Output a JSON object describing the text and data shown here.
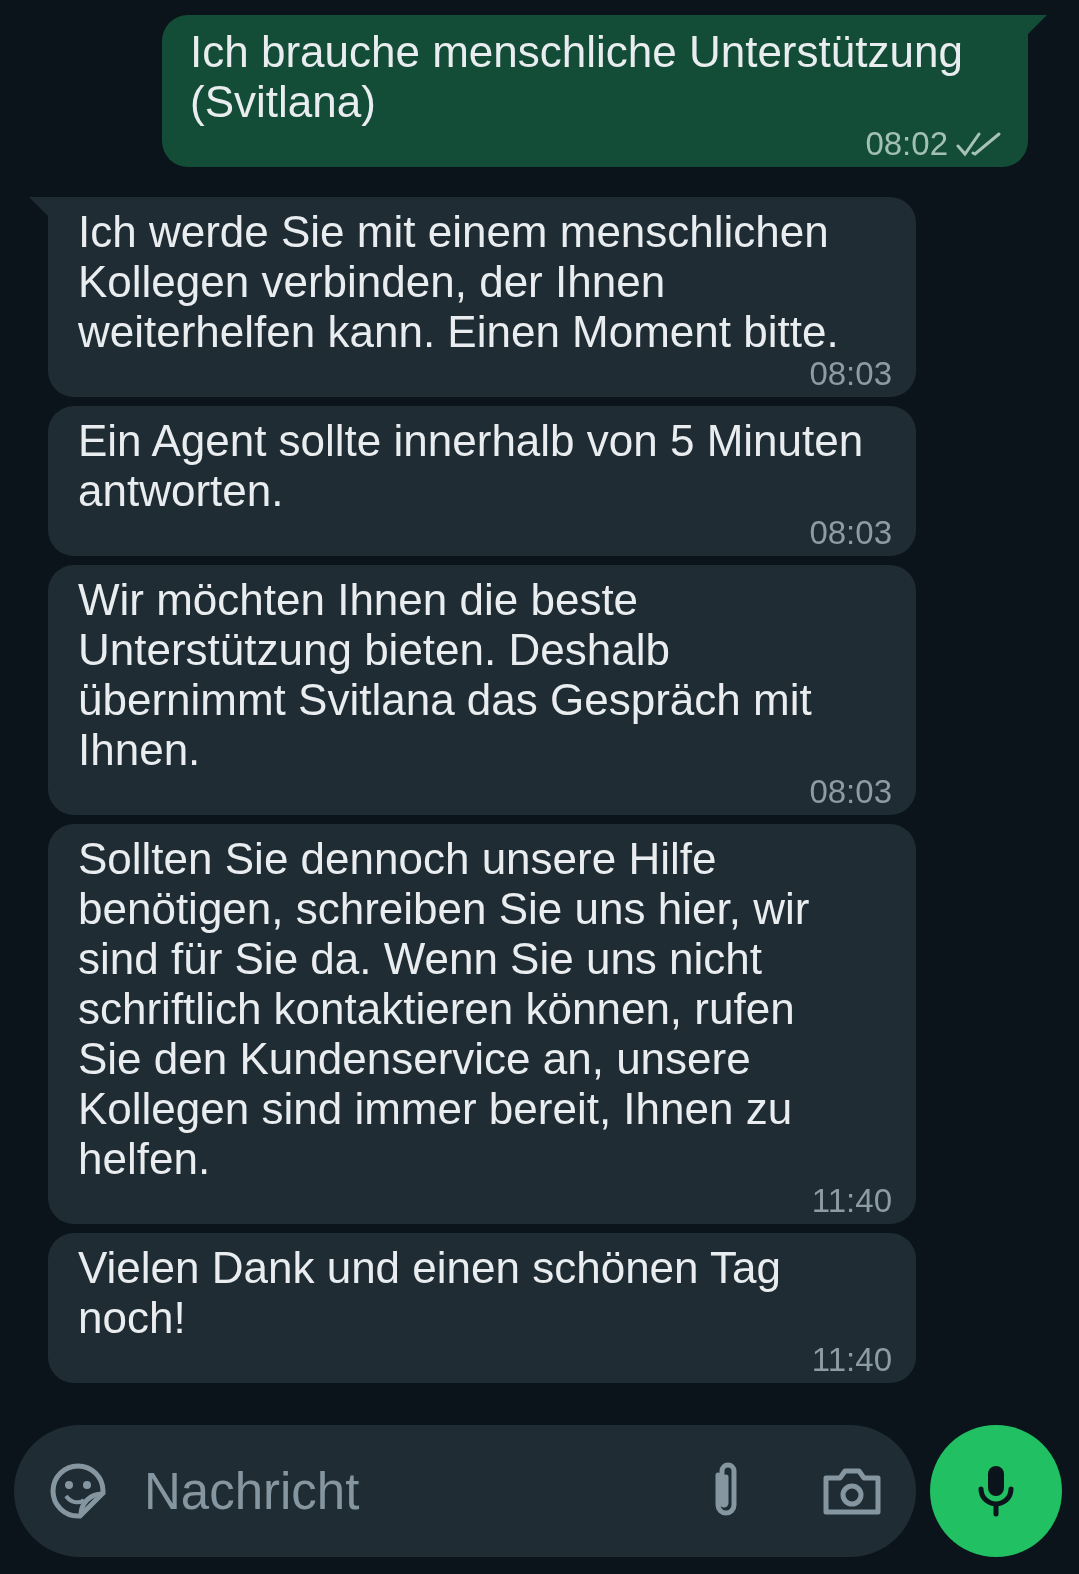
{
  "messages": [
    {
      "outgoing": true,
      "text": "Ich brauche menschliche Unterstützung\n(Svitlana)",
      "time": "08:02",
      "delivered": true,
      "tail": true
    },
    {
      "outgoing": false,
      "text": "Ich werde Sie mit einem menschlichen\nKollegen verbinden, der Ihnen\nweiterhelfen kann. Einen Moment bitte.",
      "time": "08:03",
      "tail": true
    },
    {
      "outgoing": false,
      "text": "Ein Agent sollte innerhalb von 5 Minuten\nantworten.",
      "time": "08:03",
      "tail": false
    },
    {
      "outgoing": false,
      "text": "Wir möchten Ihnen die beste\nUnterstützung bieten. Deshalb\nübernimmt Svitlana das Gespräch mit\nIhnen.",
      "time": "08:03",
      "tail": false
    },
    {
      "outgoing": false,
      "text": "Sollten Sie dennoch unsere Hilfe\nbenötigen, schreiben Sie uns hier, wir\nsind für Sie da. Wenn Sie uns nicht\nschriftlich kontaktieren können, rufen\nSie den Kundenservice an, unsere\nKollegen sind immer bereit, Ihnen zu\nhelfen.",
      "time": "11:40",
      "tail": false
    },
    {
      "outgoing": false,
      "text": "Vielen Dank und einen schönen Tag\nnoch!",
      "time": "11:40",
      "tail": false
    }
  ],
  "composer": {
    "placeholder": "Nachricht"
  }
}
